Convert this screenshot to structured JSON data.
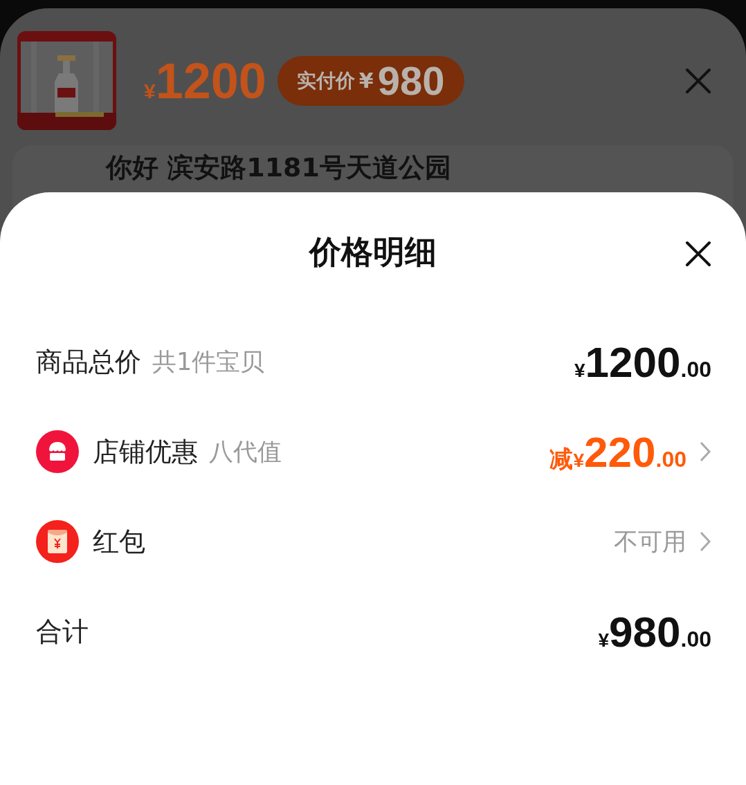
{
  "background": {
    "product": {
      "kind": "picture",
      "price_currency": "¥",
      "price": "1200",
      "paid_badge": {
        "label": "实付价",
        "currency": "¥",
        "amount": "980"
      }
    },
    "address": "你好 滨安路1181号天道公园"
  },
  "sheet": {
    "title": "价格明细",
    "rows": [
      {
        "kind": "plain",
        "label": "商品总价",
        "note": "共1件宝贝",
        "value": {
          "currency": "¥",
          "amount": "1200",
          "decimals": ".00"
        },
        "highlight": false,
        "chevron": false
      },
      {
        "kind": "store",
        "label": "店铺优惠",
        "note": "八代值",
        "value": {
          "prefix": "减",
          "currency": "¥",
          "amount": "220",
          "decimals": ".00"
        },
        "highlight": true,
        "chevron": true
      },
      {
        "kind": "red-packet",
        "label": "红包",
        "status": "不可用",
        "chevron": true
      },
      {
        "kind": "plain",
        "label": "合计",
        "value": {
          "currency": "¥",
          "amount": "980",
          "decimals": ".00"
        },
        "highlight": false,
        "chevron": false
      }
    ]
  }
}
